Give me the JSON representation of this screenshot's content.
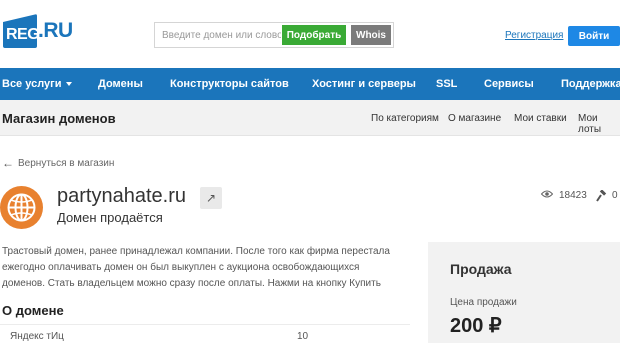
{
  "header": {
    "logo_mark": "REG",
    "logo_suffix": ".RU",
    "search_placeholder": "Введите домен или слово",
    "pick_button": "Подобрать",
    "whois_button": "Whois",
    "register_link": "Регистрация",
    "login_button": "Войти"
  },
  "nav": {
    "items": [
      "Все услуги",
      "Домены",
      "Конструкторы сайтов",
      "Хостинг и серверы",
      "SSL",
      "Сервисы",
      "Поддержка"
    ]
  },
  "subnav": {
    "title": "Магазин доменов",
    "links": [
      "По категориям",
      "О магазине",
      "Мои ставки",
      "Мои лоты"
    ]
  },
  "back_link": "Вернуться в магазин",
  "domain": {
    "name": "partynahate.ru",
    "status": "Домен продаётся",
    "views": "18423",
    "bids": "0"
  },
  "description": "Трастовый домен, ранее принадлежал компании. После того как фирма перестала ежегодно оплачивать домен он был выкуплен с аукциона освобождающихся доменов. Стать владельцем можно сразу после оплаты. Нажми на кнопку Купить",
  "about": {
    "title": "О домене",
    "rows": [
      {
        "label": "Яндекс тИц",
        "value": "10"
      }
    ]
  },
  "sale": {
    "title": "Продажа",
    "price_label": "Цена продажи",
    "price": "200 ₽"
  },
  "colors": {
    "brand_blue": "#1b75bb",
    "pick_green": "#3aaa35",
    "globe_orange": "#e8812f"
  }
}
